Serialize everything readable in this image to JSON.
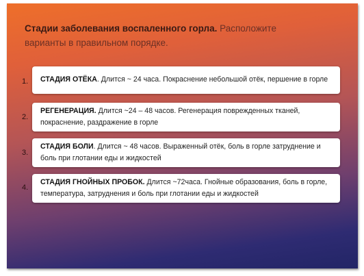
{
  "slide": {
    "title_bold": "Стадии заболевания  воспаленного горла.",
    "title_rest": " Расположите варианты в правильном порядке."
  },
  "items": [
    {
      "number": "1.",
      "name": "СТАДИЯ ОТЁКА",
      "description": ". Длится ~ 24 часа. Покраснение небольшой  отёк, першение в горле"
    },
    {
      "number": "2.",
      "name": "РЕГЕНЕРАЦИЯ.",
      "description": " Длится ~24 – 48 часов.  Регенерация поврежденных  тканей, покраснение, раздражение в горле"
    },
    {
      "number": "3.",
      "name": "СТАДИЯ БОЛИ",
      "description": ". Длится ~ 48 часов.  Выраженный отёк, боль в  горле затруднение и боль при глотании еды и жидкостей"
    },
    {
      "number": "4.",
      "name": "СТАДИЯ  ГНОЙНЫХ ПРОБОК.",
      "description": " Длится ~72часа. Гнойные образования, боль в  горле, температура, затруднения и  боль при глотании еды и жидкостей"
    }
  ]
}
